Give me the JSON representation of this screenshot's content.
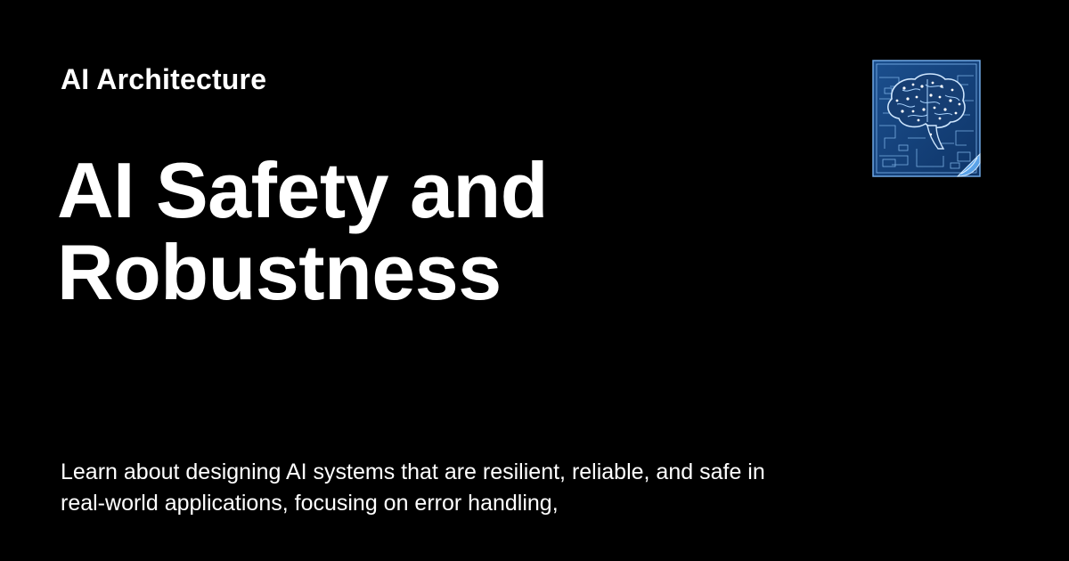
{
  "site": {
    "name": "AI Architecture",
    "logo_icon": "brain-blueprint-icon"
  },
  "article": {
    "title": "AI Safety and Robustness",
    "description": "Learn about designing AI systems that are resilient, reliable, and safe in real-world applications, focusing on error handling,"
  },
  "colors": {
    "background": "#000000",
    "text": "#ffffff",
    "logo_blue": "#1f5fa8",
    "logo_line": "#9fd0ff"
  }
}
